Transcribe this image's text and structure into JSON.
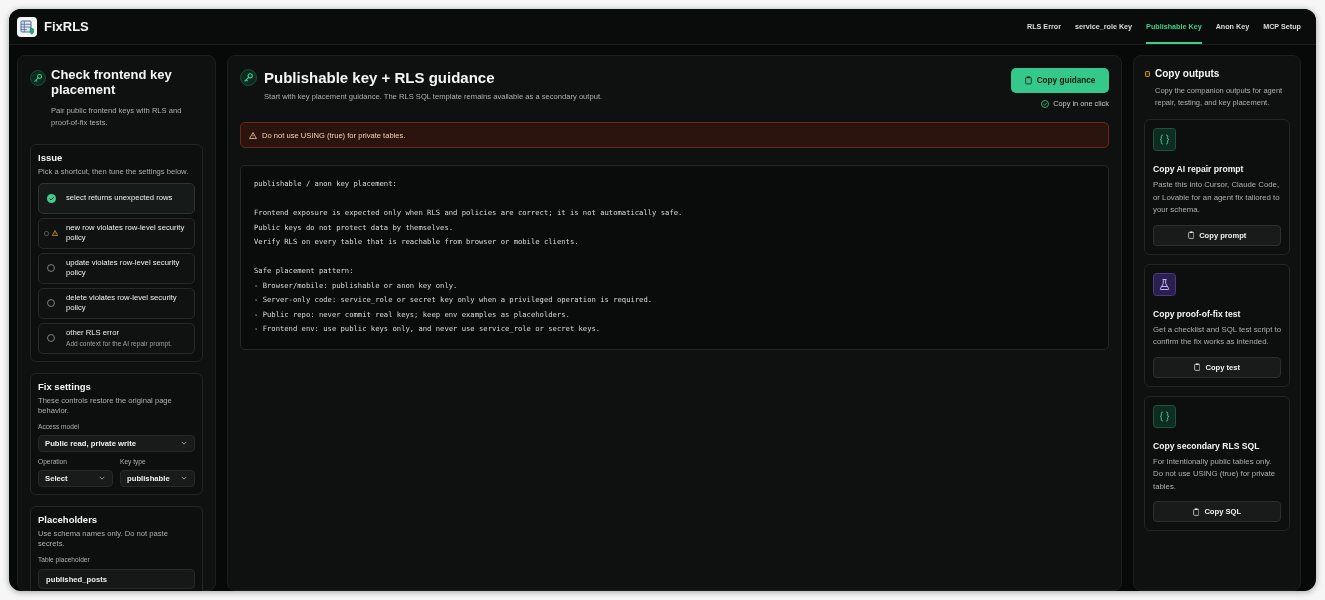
{
  "app": {
    "name": "FixRLS"
  },
  "nav": [
    {
      "label": "RLS Error",
      "selected": false
    },
    {
      "label": "service_role Key",
      "selected": false
    },
    {
      "label": "Publishable Key",
      "selected": true
    },
    {
      "label": "Anon Key",
      "selected": false
    },
    {
      "label": "MCP Setup",
      "selected": false
    }
  ],
  "sidebar": {
    "title": "Check frontend key placement",
    "subtitle": "Pair public frontend keys with RLS and proof-of-fix tests.",
    "issue": {
      "title": "Issue",
      "hint": "Pick a shortcut, then tune the settings below.",
      "options": [
        {
          "label": "select returns unexpected rows",
          "selected": true,
          "warning": false
        },
        {
          "label": "new row violates row-level security policy",
          "selected": false,
          "warning": true
        },
        {
          "label": "update violates row-level security policy",
          "selected": false,
          "warning": false
        },
        {
          "label": "delete violates row-level security policy",
          "selected": false,
          "warning": false
        },
        {
          "label": "other RLS error",
          "note": "Add context for the AI repair prompt.",
          "selected": false,
          "warning": false
        }
      ]
    },
    "fix_settings": {
      "title": "Fix settings",
      "description": "These controls restore the original page behavior.",
      "fields": [
        {
          "kind": "select",
          "label": "Access model",
          "value": "Public read, private write"
        },
        {
          "kind": "select",
          "label": "Operation",
          "value": "Select"
        },
        {
          "kind": "select",
          "label": "Key type",
          "value": "publishable"
        }
      ]
    },
    "placeholders": {
      "title": "Placeholders",
      "description": "Use schema names only. Do not paste secrets.",
      "fields": [
        {
          "kind": "text",
          "label": "Table placeholder",
          "value": "published_posts"
        }
      ]
    }
  },
  "main": {
    "title": "Publishable key + RLS guidance",
    "subtitle": "Start with key placement guidance. The RLS SQL template remains available as a secondary output.",
    "button": "Copy guidance",
    "copy_note": "Copy in one click",
    "alert": "Do not use USING (true) for private tables.",
    "code": "publishable / anon key placement:\n\nFrontend exposure is expected only when RLS and policies are correct; it is not automatically safe.\nPublic keys do not protect data by themselves.\nVerify RLS on every table that is reachable from browser or mobile clients.\n\nSafe placement pattern:\n- Browser/mobile: publishable or anon key only.\n- Server-only code: service_role or secret key only when a privileged operation is required.\n- Public repo: never commit real keys; keep env examples as placeholders.\n- Frontend env: use public keys only, and never use service_role or secret keys."
  },
  "outputs": {
    "title": "Copy outputs",
    "description": "Copy the companion outputs for agent repair, testing, and key placement.",
    "cards": [
      {
        "kind": "code",
        "title": "Copy AI repair prompt",
        "description": "Paste this into Cursor, Claude Code, or Lovable for an agent fix tailored to your schema.",
        "button": "Copy prompt"
      },
      {
        "kind": "test",
        "title": "Copy proof-of-fix test",
        "description": "Get a checklist and SQL test script to confirm the fix works as intended.",
        "button": "Copy test"
      },
      {
        "kind": "code",
        "title": "Copy secondary RLS SQL",
        "description": "For intentionally public tables only. Do not use USING (true) for private tables.",
        "button": "Copy SQL"
      }
    ]
  }
}
